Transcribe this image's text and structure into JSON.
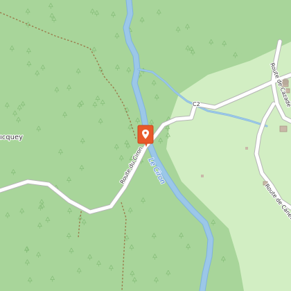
{
  "map": {
    "colors": {
      "forest": "#a8d59a",
      "open_field": "#d2eec3",
      "water": "#9bc7e8",
      "water_edge": "#7fb2dc",
      "road_casing": "#b5b5b5",
      "road": "#ffffff",
      "path": "#9a7a4a",
      "tree_symbol": "#86be79",
      "marker": "#e8592a"
    },
    "labels": {
      "road_route_du_ciron": "Route du Ciron",
      "road_route_de_cazade": "Route de Cazade",
      "road_route_de_canet": "Route de Canet",
      "road_c2": "C2",
      "river_le_ciron": "Le Ciron",
      "place_partial": "ıcquey"
    },
    "marker": {
      "icon": "map-pin-icon"
    }
  }
}
